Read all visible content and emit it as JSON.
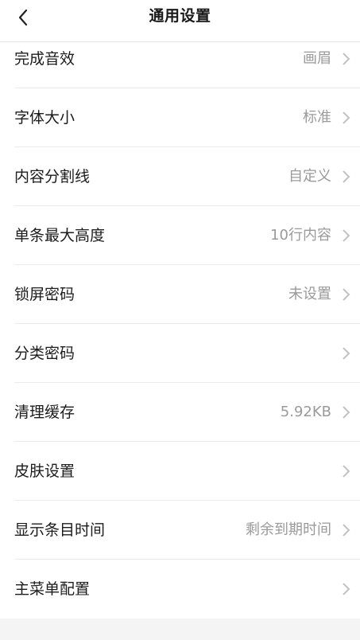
{
  "header": {
    "title": "通用设置",
    "back_icon": "chevron-left-icon"
  },
  "settings": [
    {
      "label": "完成音效",
      "value": "画眉"
    },
    {
      "label": "字体大小",
      "value": "标准"
    },
    {
      "label": "内容分割线",
      "value": "自定义"
    },
    {
      "label": "单条最大高度",
      "value": "10行内容"
    },
    {
      "label": "锁屏密码",
      "value": "未设置"
    },
    {
      "label": "分类密码",
      "value": ""
    },
    {
      "label": "清理缓存",
      "value": "5.92KB"
    },
    {
      "label": "皮肤设置",
      "value": ""
    },
    {
      "label": "显示条目时间",
      "value": "剩余到期时间"
    },
    {
      "label": "主菜单配置",
      "value": ""
    }
  ],
  "colors": {
    "text": "#1c1c1c",
    "secondary": "#9a9a9a",
    "divider": "#ececec"
  }
}
